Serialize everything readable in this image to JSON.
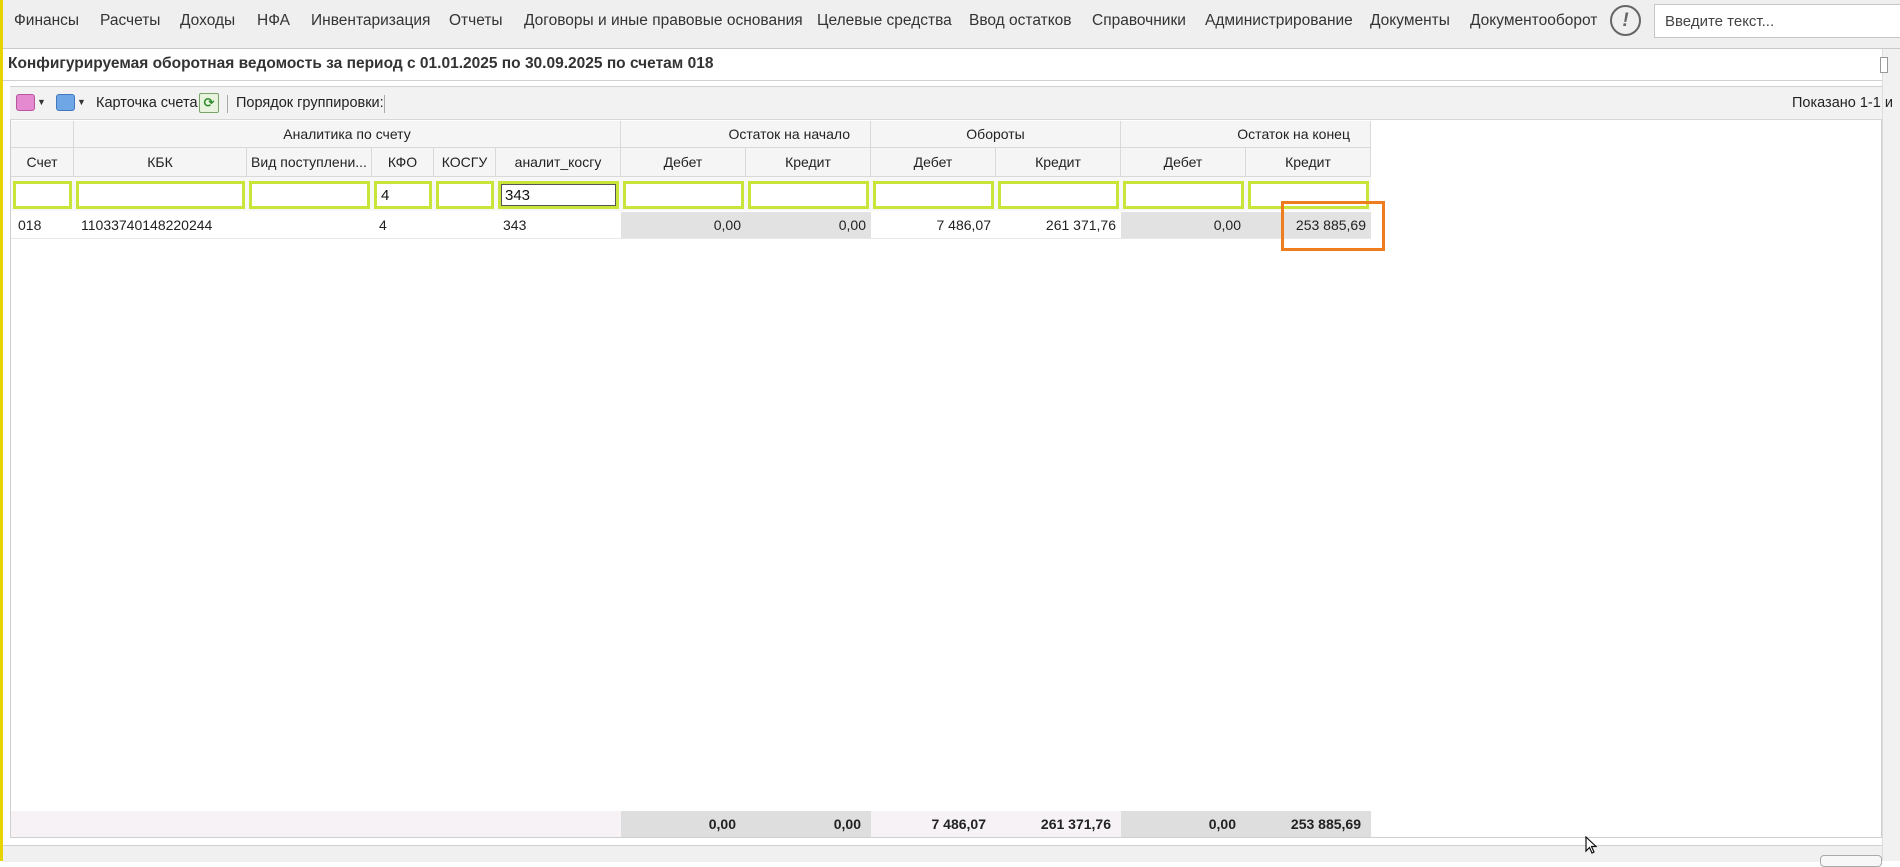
{
  "menu": {
    "items": [
      "Финансы",
      "Расчеты",
      "Доходы",
      "НФА",
      "Инвентаризация",
      "Отчеты",
      "Договоры и иные правовые основания",
      "Целевые средства",
      "Ввод остатков",
      "Справочники",
      "Администрирование",
      "Документы",
      "Документооборот"
    ],
    "search_placeholder": "Введите текст..."
  },
  "title": "Конфигурируемая оборотная ведомость за период с 01.01.2025 по 30.09.2025 по счетам 018",
  "toolbar": {
    "account_card": "Карточка счета",
    "grouping_order": "Порядок группировки:",
    "shown": "Показано 1-1 и"
  },
  "grid": {
    "bands": {
      "analytics": "Аналитика по счету",
      "opening": "Остаток на начало",
      "turnover": "Обороты",
      "closing": "Остаток на конец"
    },
    "columns": {
      "account": "Счет",
      "kbk": "КБК",
      "income_type": "Вид поступлени...",
      "kfo": "КФО",
      "kosgu": "КОСГУ",
      "analit_kosgu": "аналит_косгу",
      "open_debit": "Дебет",
      "open_credit": "Кредит",
      "turn_debit": "Дебет",
      "turn_credit": "Кредит",
      "close_debit": "Дебет",
      "close_credit": "Кредит"
    },
    "filters": {
      "kfo": "4",
      "analit_kosgu": "343"
    },
    "row": {
      "account": "018",
      "kbk": "11033740148220244",
      "income_type": "",
      "kfo": "4",
      "kosgu": "",
      "analit_kosgu": "343",
      "open_debit": "0,00",
      "open_credit": "0,00",
      "turn_debit": "7 486,07",
      "turn_credit": "261 371,76",
      "close_debit": "0,00",
      "close_credit": "253 885,69"
    },
    "totals": {
      "open_debit": "0,00",
      "open_credit": "0,00",
      "turn_debit": "7 486,07",
      "turn_credit": "261 371,76",
      "close_debit": "0,00",
      "close_credit": "253 885,69"
    }
  },
  "colors": {
    "filter_border": "#c8e63a",
    "highlight": "#ef7c1d",
    "left_accent": "#e6d400"
  }
}
